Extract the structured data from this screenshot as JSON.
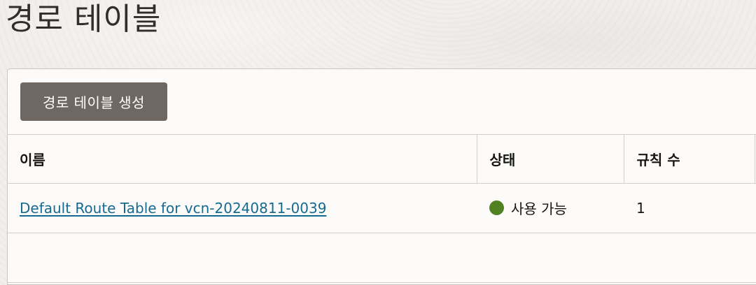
{
  "page": {
    "title": "경로 테이블"
  },
  "toolbar": {
    "create_label": "경로 테이블 생성"
  },
  "table": {
    "columns": [
      "이름",
      "상태",
      "규칙 수"
    ],
    "rows": [
      {
        "name": "Default Route Table for vcn-20240811-0039",
        "status": "사용 가능",
        "status_color": "#508223",
        "rule_count": "1"
      }
    ]
  }
}
